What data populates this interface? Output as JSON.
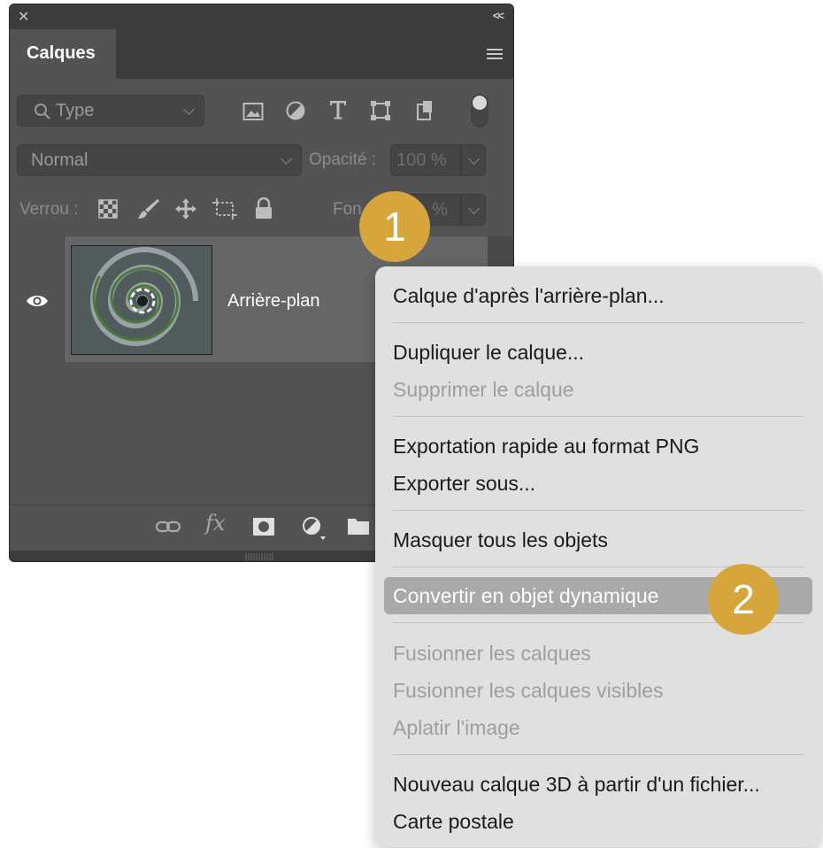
{
  "panel": {
    "tab": "Calques",
    "filter": {
      "placeholder": "Type"
    },
    "blend_mode": "Normal",
    "opacity_label": "Opacité :",
    "opacity_value": "100 %",
    "lock_label": "Verrou :",
    "fill_label_visible": "Fon",
    "fill_value_visible": "%",
    "layer_name": "Arrière-plan"
  },
  "badges": {
    "one": "1",
    "two": "2"
  },
  "menu": {
    "items": [
      "Calque d'après l'arrière-plan...",
      "Dupliquer le calque...",
      "Supprimer le calque",
      "Exportation rapide au format PNG",
      "Exporter sous...",
      "Masquer tous les objets",
      "Convertir en objet dynamique",
      "Fusionner les calques",
      "Fusionner les calques visibles",
      "Aplatir l'image",
      "Nouveau calque 3D à partir d'un fichier...",
      "Carte postale"
    ]
  },
  "colors": {
    "panel_bg": "#535353",
    "badge": "#d6a53b",
    "menu_bg": "#e0e0e0",
    "highlight": "#a9a9a9"
  }
}
